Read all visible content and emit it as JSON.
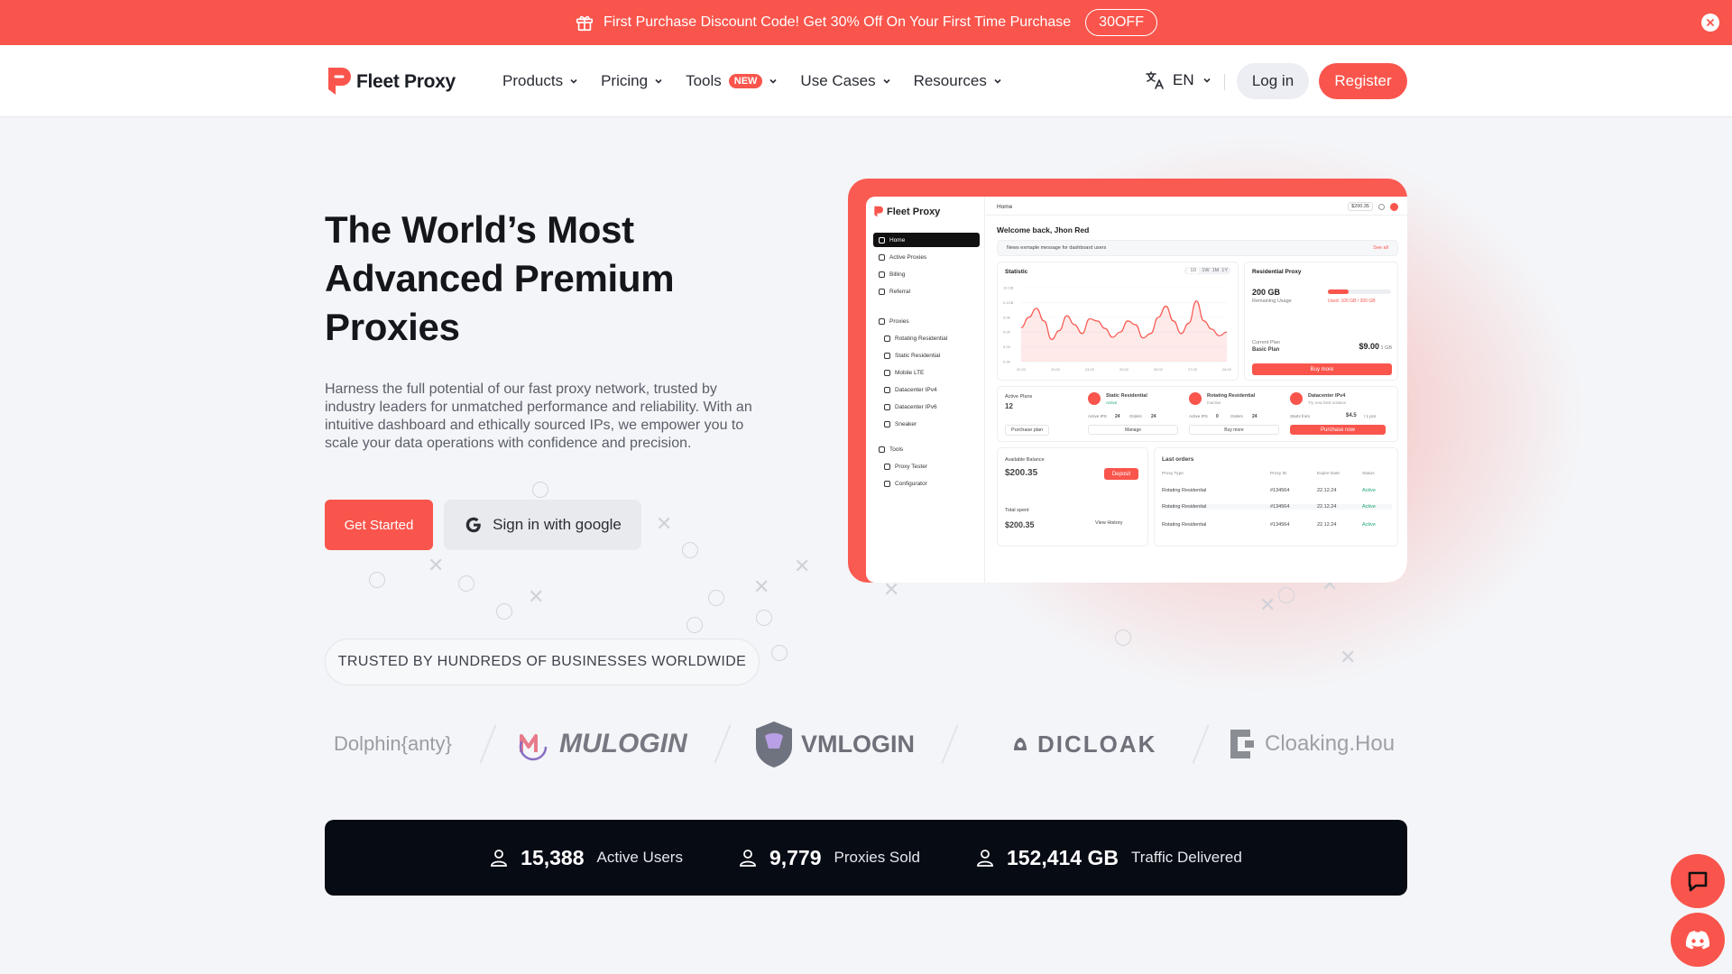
{
  "promo": {
    "text": "First Purchase Discount Code! Get 30% Off On Your First Time Purchase",
    "code": "30OFF"
  },
  "header": {
    "brand": "Fleet Proxy",
    "nav": [
      {
        "label": "Products"
      },
      {
        "label": "Pricing"
      },
      {
        "label": "Tools",
        "badge": "NEW"
      },
      {
        "label": "Use Cases"
      },
      {
        "label": "Resources"
      }
    ],
    "language": "EN",
    "login": "Log in",
    "register": "Register"
  },
  "hero": {
    "title": "The World’s Most Advanced Premium Proxies",
    "description": "Harness the full potential of our fast proxy network, trusted by industry leaders for unmatched performance and reliability. With an intuitive dashboard and ethically sourced IPs, we empower you to scale your data operations with confidence and precision.",
    "cta_primary": "Get Started",
    "cta_google": "Sign in with google"
  },
  "trusted": "TRUSTED BY HUNDREDS OF BUSINESSES WORLDWIDE",
  "partners": [
    "Dolphin{anty}",
    "MULOGIN",
    "VMLOGIN",
    "DICLOAK",
    "Cloaking.Hou"
  ],
  "stats": [
    {
      "value": "15,388",
      "label": "Active Users"
    },
    {
      "value": "9,779",
      "label": "Proxies Sold"
    },
    {
      "value": "152,414 GB",
      "label": "Traffic Delivered"
    }
  ],
  "dashboard": {
    "brand": "Fleet Proxy",
    "sidebar": [
      "Home",
      "Active Proxies",
      "Billing",
      "Referral",
      "Proxies",
      "Rotating Residential",
      "Static Residential",
      "Mobile LTE",
      "Datacenter IPv4",
      "Datacenter IPv6",
      "Sneaker",
      "Tools",
      "Proxy Tester",
      "Configurator"
    ],
    "crumb": "Home",
    "balance_top": "$200.35",
    "welcome": "Welcome back, Jhon Red",
    "news": "News exmaple message for dashboard users",
    "see_all": "See all",
    "statistic": "Statistic",
    "ranges": [
      "1D",
      "1W",
      "1M",
      "1Y"
    ],
    "y_ticks": [
      "10 GB",
      "0.1GB",
      "0.06",
      "0.04",
      "0.03",
      "0.00"
    ],
    "x_ticks": [
      "22.02",
      "23.02",
      "24.02",
      "25.02",
      "26.02",
      "27.02",
      "28.02"
    ],
    "residential": {
      "title": "Residential Proxy",
      "amount": "200 GB",
      "remaining": "Remaining Usage",
      "used": "Used: 100 GB / 300 GB",
      "plan_label": "Current Plan",
      "plan": "Basic Plan",
      "price": "$9.00",
      "unit": "/ 1 GB",
      "buy": "Buy more"
    },
    "active_plans": {
      "label": "Active Plans",
      "count": "12",
      "button": "Purchase plan"
    },
    "products": [
      {
        "name": "Static Residential",
        "status": "Active",
        "ips_label": "Active IPS",
        "ips": "24",
        "orders_label": "Orders",
        "orders": "24",
        "button": "Manage"
      },
      {
        "name": "Rotating Residential",
        "status": "Inactive",
        "ips_label": "Active IPS",
        "ips": "0",
        "orders_label": "Orders",
        "orders": "24",
        "button": "Buy more"
      },
      {
        "name": "Datacenter IPv4",
        "status": "Try now best solution",
        "ips_label": "Starts from",
        "ips": "$4.5",
        "orders_label": "/ 1 pcs",
        "orders": "",
        "button": "Purchase now"
      }
    ],
    "balance": {
      "label": "Available Balance",
      "value": "$200.35",
      "deposit": "Deposit",
      "spent_label": "Total spent",
      "spent": "$200.35",
      "history": "View History"
    },
    "orders": {
      "title": "Last orders",
      "headers": [
        "Proxy Type",
        "Proxy ID",
        "Expire Date",
        "Status"
      ],
      "rows": [
        {
          "type": "Rotating Residential",
          "id": "#134564",
          "date": "22.12.24",
          "status": "Active"
        },
        {
          "type": "Rotating Residential",
          "id": "#134564",
          "date": "22.12.24",
          "status": "Active"
        },
        {
          "type": "Rotating Residential",
          "id": "#134564",
          "date": "22.12.24",
          "status": "Active"
        }
      ]
    },
    "chart_series": [
      0.46,
      0.6,
      0.72,
      0.55,
      0.3,
      0.42,
      0.62,
      0.5,
      0.38,
      0.58,
      0.55,
      0.45,
      0.33,
      0.4,
      0.55,
      0.5,
      0.32,
      0.38,
      0.6,
      0.75,
      0.55,
      0.38,
      0.52,
      0.82,
      0.55,
      0.44,
      0.35,
      0.4
    ]
  },
  "colors": {
    "accent": "#f9554c",
    "dark": "#070b14",
    "background": "#f4f5f8"
  }
}
